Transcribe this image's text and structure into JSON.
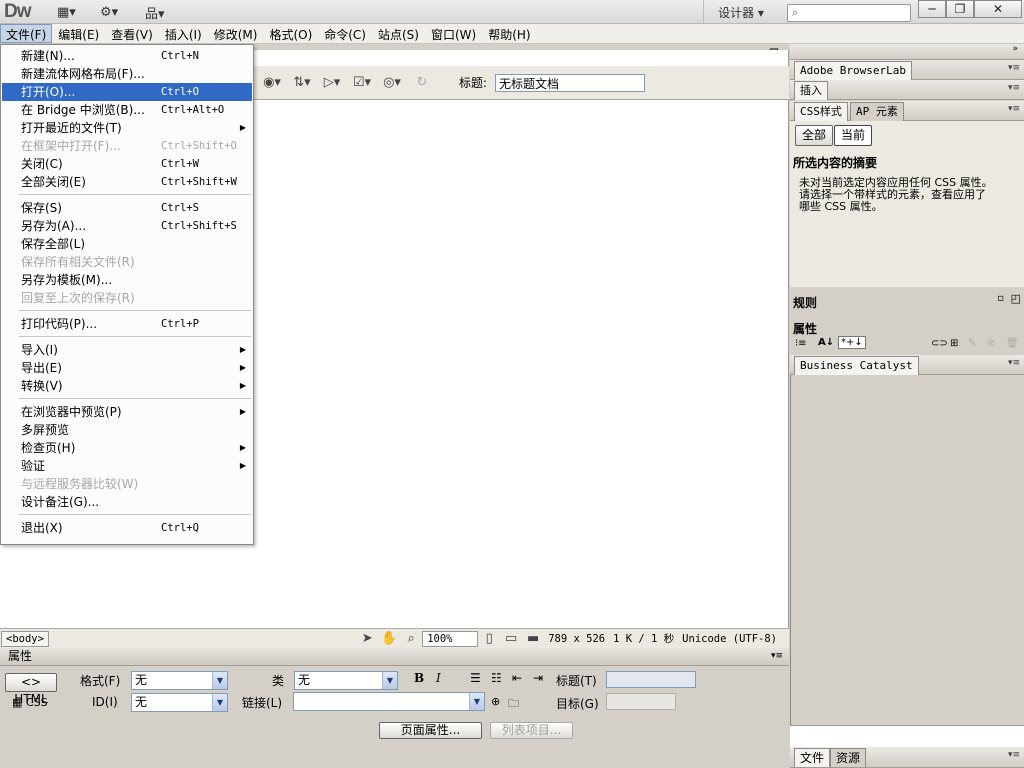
{
  "app": {
    "logo": "Dw",
    "workspace": "设计器 ▾"
  },
  "menubar": [
    "文件(F)",
    "编辑(E)",
    "查看(V)",
    "插入(I)",
    "修改(M)",
    "格式(O)",
    "命令(C)",
    "站点(S)",
    "窗口(W)",
    "帮助(H)"
  ],
  "file_menu": [
    {
      "label": "新建(N)...",
      "shortcut": "Ctrl+N"
    },
    {
      "label": "新建流体网格布局(F)...",
      "shortcut": ""
    },
    {
      "label": "打开(O)...",
      "shortcut": "Ctrl+O",
      "highlight": true
    },
    {
      "label": "在 Bridge 中浏览(B)...",
      "shortcut": "Ctrl+Alt+O"
    },
    {
      "label": "打开最近的文件(T)",
      "shortcut": "",
      "submenu": true
    },
    {
      "label": "在框架中打开(F)...",
      "shortcut": "Ctrl+Shift+O",
      "disabled": true
    },
    {
      "label": "关闭(C)",
      "shortcut": "Ctrl+W"
    },
    {
      "label": "全部关闭(E)",
      "shortcut": "Ctrl+Shift+W"
    },
    {
      "sep": true
    },
    {
      "label": "保存(S)",
      "shortcut": "Ctrl+S"
    },
    {
      "label": "另存为(A)...",
      "shortcut": "Ctrl+Shift+S"
    },
    {
      "label": "保存全部(L)",
      "shortcut": ""
    },
    {
      "label": "保存所有相关文件(R)",
      "shortcut": "",
      "disabled": true
    },
    {
      "label": "另存为模板(M)...",
      "shortcut": ""
    },
    {
      "label": "回复至上次的保存(R)",
      "shortcut": "",
      "disabled": true
    },
    {
      "sep": true
    },
    {
      "label": "打印代码(P)...",
      "shortcut": "Ctrl+P"
    },
    {
      "sep": true
    },
    {
      "label": "导入(I)",
      "shortcut": "",
      "submenu": true
    },
    {
      "label": "导出(E)",
      "shortcut": "",
      "submenu": true
    },
    {
      "label": "转换(V)",
      "shortcut": "",
      "submenu": true
    },
    {
      "sep": true
    },
    {
      "label": "在浏览器中预览(P)",
      "shortcut": "",
      "submenu": true
    },
    {
      "label": "多屏预览",
      "shortcut": ""
    },
    {
      "label": "检查页(H)",
      "shortcut": "",
      "submenu": true
    },
    {
      "label": "验证",
      "shortcut": "",
      "submenu": true
    },
    {
      "label": "与远程服务器比较(W)",
      "shortcut": "",
      "disabled": true
    },
    {
      "label": "设计备注(G)...",
      "shortcut": ""
    },
    {
      "sep": true
    },
    {
      "label": "退出(X)",
      "shortcut": "Ctrl+Q"
    }
  ],
  "doc_toolbar": {
    "title_label": "标题:",
    "title_value": "无标题文档"
  },
  "statusbar": {
    "tag": "<body>",
    "zoom": "100%",
    "size": "789 x 526",
    "filesize": "1 K / 1 秒",
    "encoding": "Unicode (UTF-8)"
  },
  "properties": {
    "header": "属性",
    "html_btn": "HTML",
    "css_btn": "CSS",
    "format_label": "格式(F)",
    "format_value": "无",
    "class_label": "类",
    "class_value": "无",
    "id_label": "ID(I)",
    "id_value": "无",
    "link_label": "链接(L)",
    "title_label": "标题(T)",
    "target_label": "目标(G)",
    "page_props": "页面属性...",
    "list_items": "列表项目..."
  },
  "panels": {
    "browserlab": "Adobe BrowserLab",
    "insert": "插入",
    "css_tab": "CSS样式",
    "ap_tab": "AP 元素",
    "all_btn": "全部",
    "current_btn": "当前",
    "summary_title": "所选内容的摘要",
    "summary_text_1": "未对当前选定内容应用任何 CSS 属性。",
    "summary_text_2": "请选择一个带样式的元素，查看应用了",
    "summary_text_3": "哪些 CSS 属性。",
    "rules": "规则",
    "props": "属性",
    "bc": "Business Catalyst",
    "files_tab": "文件",
    "assets_tab": "资源"
  }
}
